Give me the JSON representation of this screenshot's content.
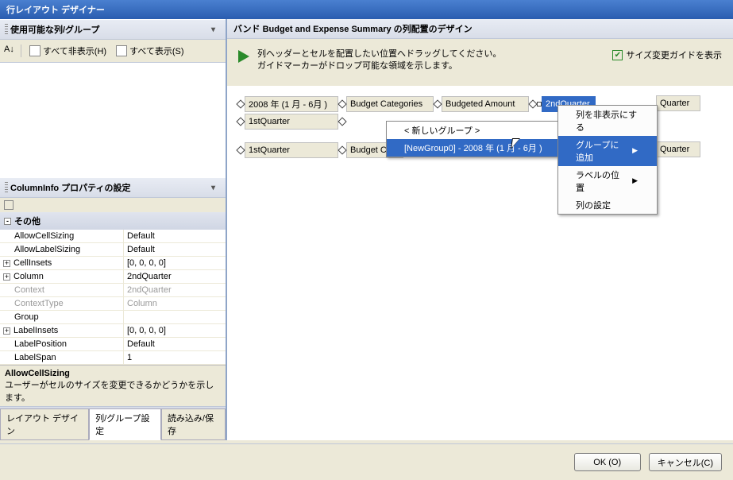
{
  "title": "行レイアウト デザイナー",
  "left": {
    "available_header": "使用可能な列/グループ",
    "sort_icon": "AZ",
    "hide_all": "すべて非表示(H)",
    "show_all": "すべて表示(S)"
  },
  "columninfo_header": "ColumnInfo プロパティの設定",
  "prop_category": "その他",
  "props": [
    {
      "name": "AllowCellSizing",
      "value": "Default",
      "exp": false
    },
    {
      "name": "AllowLabelSizing",
      "value": "Default",
      "exp": false
    },
    {
      "name": "CellInsets",
      "value": "[0, 0, 0, 0]",
      "exp": true
    },
    {
      "name": "Column",
      "value": "2ndQuarter",
      "exp": true
    },
    {
      "name": "Context",
      "value": "2ndQuarter",
      "exp": false,
      "disabled": true
    },
    {
      "name": "ContextType",
      "value": "Column",
      "exp": false,
      "disabled": true
    },
    {
      "name": "Group",
      "value": "",
      "exp": false
    },
    {
      "name": "LabelInsets",
      "value": "[0, 0, 0, 0]",
      "exp": true
    },
    {
      "name": "LabelPosition",
      "value": "Default",
      "exp": false
    },
    {
      "name": "LabelSpan",
      "value": "1",
      "exp": false
    }
  ],
  "desc": {
    "title": "AllowCellSizing",
    "text": "ユーザーがセルのサイズを変更できるかどうかを示します。"
  },
  "tabs": {
    "layout": "レイアウト デザイン",
    "colgroup": "列/グループ設定",
    "loadsave": "読み込み/保存"
  },
  "right_header_prefix": "バンド ",
  "right_header_name": "Budget and Expense Summary",
  "right_header_suffix": " の列配置のデザイン",
  "help": {
    "line1": "列ヘッダーとセルを配置したい位置へドラッグしてください。",
    "line2": "ガイドマーカーがドロップ可能な領域を示します。"
  },
  "guide_check": "サイズ変更ガイドを表示",
  "cols": {
    "c1": "2008 年 (1 月 - 6月 )",
    "c2": "Budget Categories",
    "c3": "Budgeted Amount",
    "c4": "2ndQuarter",
    "c5": "Quarter",
    "r1": "1stQuarter",
    "r2": "1stQuarter",
    "r2b": "Budget Cate"
  },
  "ctx": {
    "hide_col": "列を非表示にする",
    "add_group": "グループに追加",
    "label_pos": "ラベルの位置",
    "col_settings": "列の設定"
  },
  "sub": {
    "new_group": "< 新しいグループ >",
    "g0": "[NewGroup0] - 2008 年 (1 月 - 6月 )"
  },
  "footer": {
    "ok": "OK (O)",
    "cancel": "キャンセル(C)"
  }
}
